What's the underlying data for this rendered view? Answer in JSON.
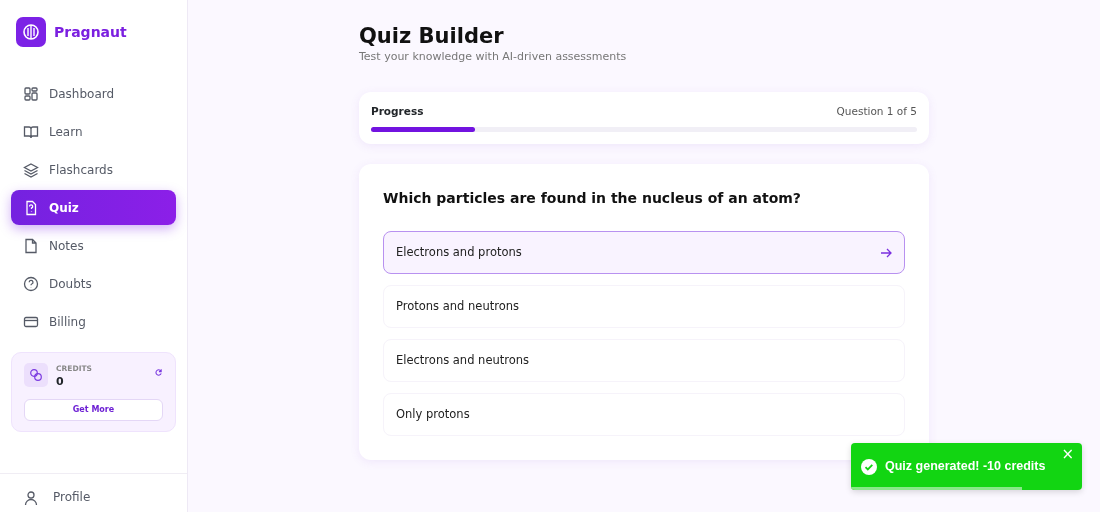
{
  "brand": {
    "name": "Pragnaut"
  },
  "sidebar": {
    "items": [
      {
        "label": "Dashboard",
        "selected": false
      },
      {
        "label": "Learn",
        "selected": false
      },
      {
        "label": "Flashcards",
        "selected": false
      },
      {
        "label": "Quiz",
        "selected": true
      },
      {
        "label": "Notes",
        "selected": false
      },
      {
        "label": "Doubts",
        "selected": false
      },
      {
        "label": "Billing",
        "selected": false
      }
    ],
    "credits": {
      "label": "CREDITS",
      "value": "0",
      "button": "Get More"
    },
    "profile": {
      "label": "Profile"
    }
  },
  "page": {
    "title": "Quiz Builder",
    "subtitle": "Test your knowledge with AI-driven assessments"
  },
  "progress": {
    "label": "Progress",
    "counter": "Question 1 of 5",
    "level": 0.19
  },
  "question": {
    "text": "Which particles are found in the nucleus of an atom?",
    "options": [
      {
        "label": "Electrons and protons",
        "selected": true
      },
      {
        "label": "Protons and neutrons",
        "selected": false
      },
      {
        "label": "Electrons and neutrons",
        "selected": false
      },
      {
        "label": "Only protons",
        "selected": false
      }
    ]
  },
  "toast": {
    "message": "Quiz generated! -10 credits",
    "close": "×",
    "level": 0.74
  }
}
